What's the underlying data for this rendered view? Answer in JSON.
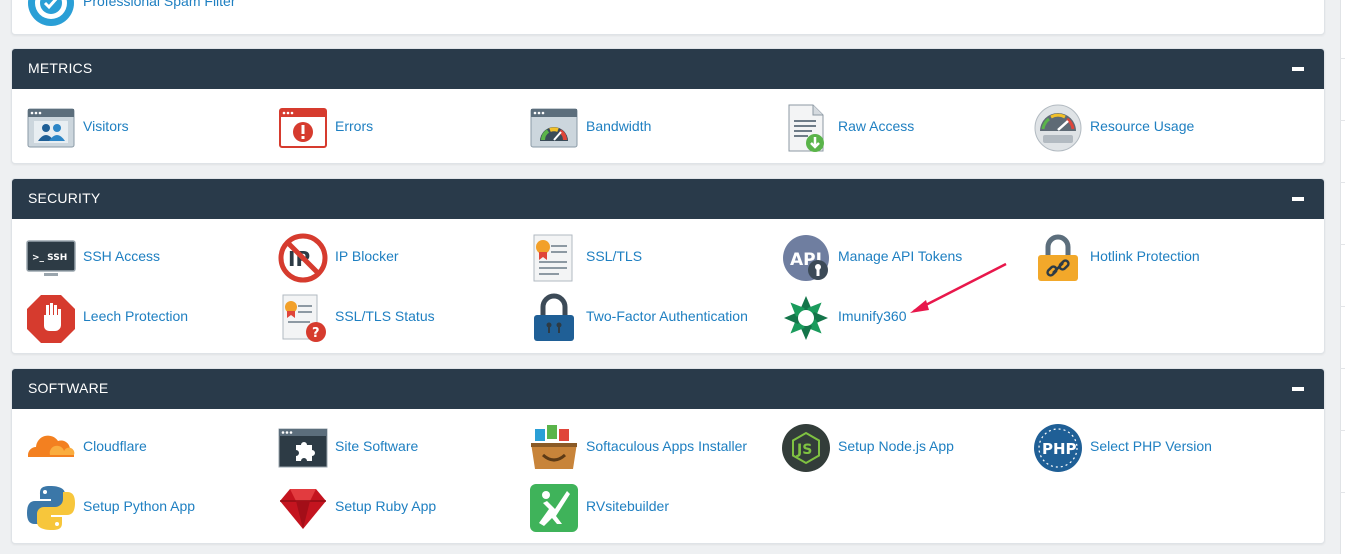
{
  "top_partial": {
    "label": "Professional Spam Filter"
  },
  "sections": {
    "metrics": {
      "title": "METRICS",
      "items": {
        "visitors": "Visitors",
        "errors": "Errors",
        "bandwidth": "Bandwidth",
        "raw_access": "Raw Access",
        "resource_usage": "Resource Usage"
      }
    },
    "security": {
      "title": "SECURITY",
      "items": {
        "ssh_access": "SSH Access",
        "ip_blocker": "IP Blocker",
        "ssl_tls": "SSL/TLS",
        "manage_api_tokens": "Manage API Tokens",
        "hotlink_protection": "Hotlink Protection",
        "leech_protection": "Leech Protection",
        "ssl_tls_status": "SSL/TLS Status",
        "two_factor": "Two-Factor Authentication",
        "imunify360": "Imunify360"
      }
    },
    "software": {
      "title": "SOFTWARE",
      "items": {
        "cloudflare": "Cloudflare",
        "site_software": "Site Software",
        "softaculous": "Softaculous Apps Installer",
        "nodejs": "Setup Node.js App",
        "php_version": "Select PHP Version",
        "python": "Setup Python App",
        "ruby": "Setup Ruby App",
        "rvsitebuilder": "RVsitebuilder"
      }
    }
  },
  "icon_texts": {
    "ssh": ">_ SSH",
    "api": "API",
    "php": "PHP",
    "js": "JS"
  },
  "colors": {
    "header_bg": "#293a4a",
    "link": "#1e7fc1",
    "annotation_arrow": "#e8174b"
  }
}
